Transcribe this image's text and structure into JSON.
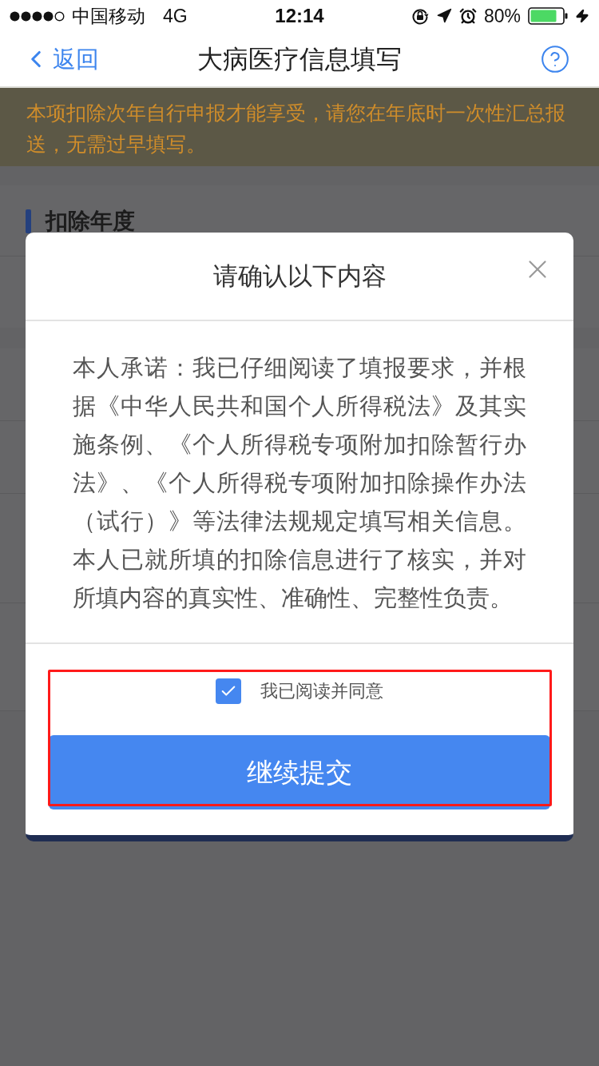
{
  "status_bar": {
    "carrier": "中国移动",
    "network": "4G",
    "time": "12:14",
    "battery": "80%"
  },
  "nav_bar": {
    "back": "返回",
    "title": "大病医疗信息填写"
  },
  "notice": "本项扣除次年自行申报才能享受，请您在年底时一次性汇总报送，无需过早填写。",
  "section": {
    "title": "扣除年度"
  },
  "dialog": {
    "title": "请确认以下内容",
    "body": "本人承诺：我已仔细阅读了填报要求，并根据《中华人民共和国个人所得税法》及其实施条例、《个人所得税专项附加扣除暂行办法》、《个人所得税专项附加扣除操作办法（试行）》等法律法规规定填写相关信息。本人已就所填的扣除信息进行了核实，并对所填内容的真实性、准确性、完整性负责。",
    "agreement": {
      "label": "我已阅读并同意",
      "checked": true
    },
    "submit": "继续提交"
  }
}
